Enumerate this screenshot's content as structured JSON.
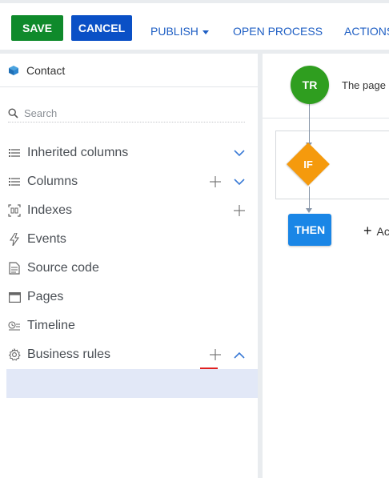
{
  "toolbar": {
    "save_label": "SAVE",
    "cancel_label": "CANCEL",
    "publish_label": "PUBLISH",
    "open_process_label": "OPEN PROCESS",
    "actions_label": "ACTIONS"
  },
  "sidebar": {
    "header": {
      "title": "Contact",
      "icon": "cube-icon"
    },
    "search": {
      "placeholder": "Search"
    },
    "items": [
      {
        "label": "Inherited columns",
        "icon": "columns-icon",
        "has_add": false,
        "chevron": "down"
      },
      {
        "label": "Columns",
        "icon": "columns-icon",
        "has_add": true,
        "chevron": "down"
      },
      {
        "label": "Indexes",
        "icon": "indexes-icon",
        "has_add": true,
        "chevron": null
      },
      {
        "label": "Events",
        "icon": "lightning-icon",
        "has_add": false,
        "chevron": null
      },
      {
        "label": "Source code",
        "icon": "source-code-icon",
        "has_add": false,
        "chevron": null
      },
      {
        "label": "Pages",
        "icon": "page-icon",
        "has_add": false,
        "chevron": null
      },
      {
        "label": "Timeline",
        "icon": "timeline-icon",
        "has_add": false,
        "chevron": null
      },
      {
        "label": "Business rules",
        "icon": "gear-icon",
        "has_add": true,
        "chevron": "up"
      }
    ]
  },
  "canvas": {
    "trigger": {
      "label": "TR",
      "text": "The page"
    },
    "condition": {
      "label": "IF"
    },
    "then": {
      "label": "THEN"
    },
    "add_action": {
      "label": "Ac"
    }
  },
  "colors": {
    "save": "#0f8a2b",
    "cancel": "#0a50c6",
    "link": "#1f5fc4",
    "trigger": "#2f9e1f",
    "condition": "#f59a0d",
    "then": "#1a86e6",
    "selected_row": "#e2e8f7",
    "annotation_mark": "#e02020"
  }
}
